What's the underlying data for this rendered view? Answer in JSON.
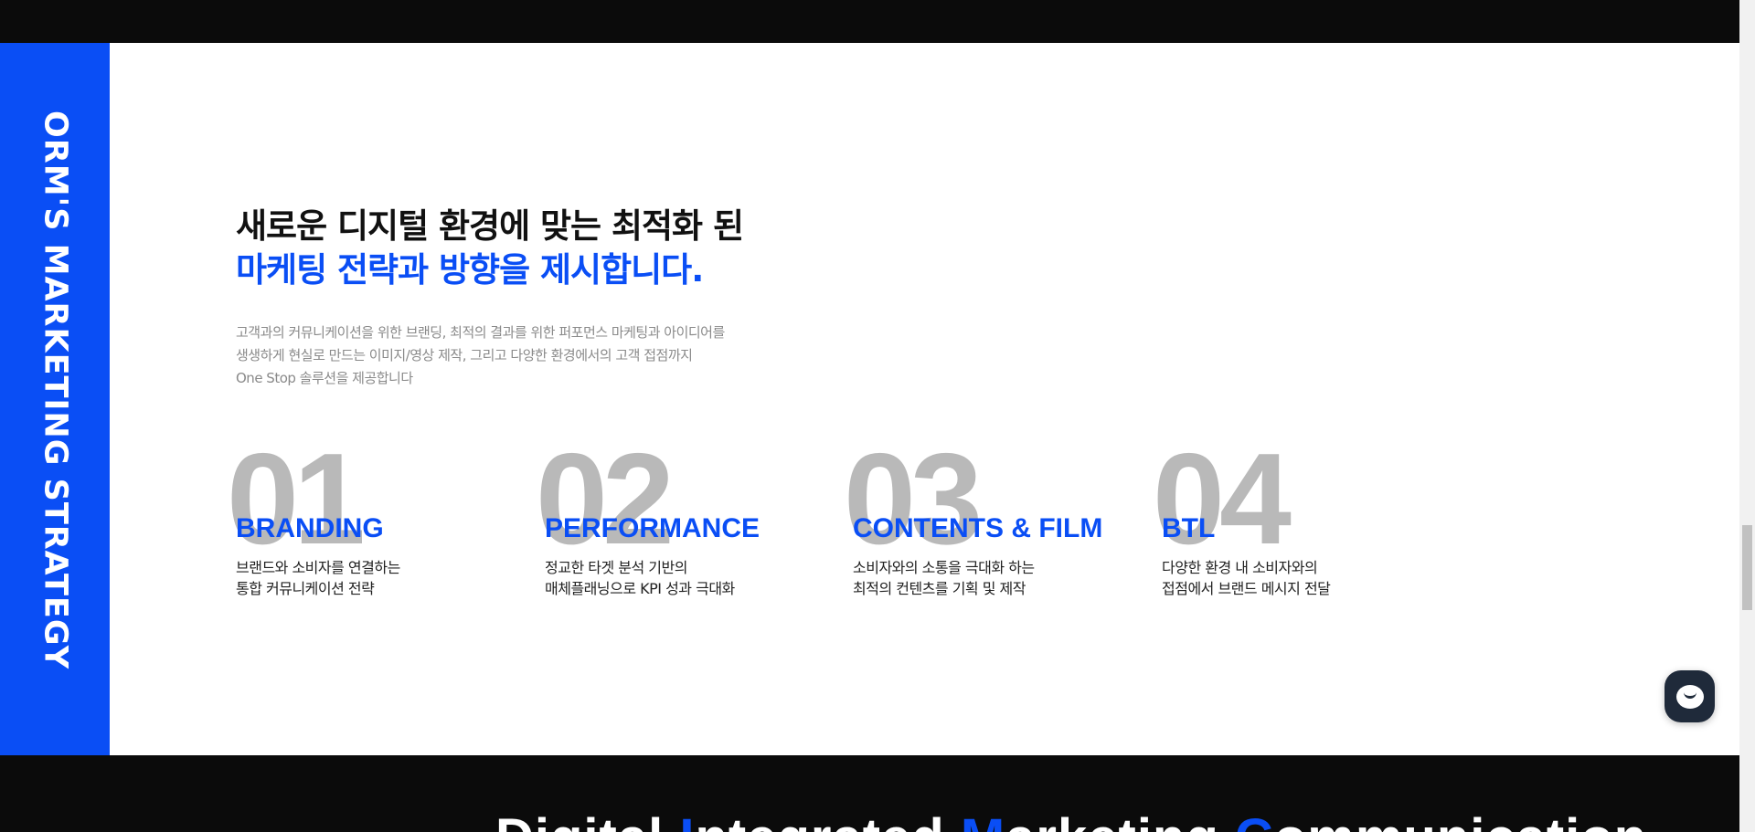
{
  "side_band": {
    "label": "ORM'S MARKETING STRATEGY"
  },
  "heading": {
    "line1": "새로운 디지털 환경에 맞는 최적화 된",
    "line2": "마케팅 전략과 방향을 제시합니다."
  },
  "description": {
    "line1": "고객과의 커뮤니케이션을 위한 브랜딩, 최적의 결과를 위한 퍼포먼스 마케팅과 아이디어를",
    "line2": "생생하게 현실로 만드는 이미지/영상 제작, 그리고 다양한 환경에서의 고객 접점까지",
    "line3": "One Stop 솔루션을 제공합니다"
  },
  "features": [
    {
      "number": "01",
      "title": "BRANDING",
      "desc1": "브랜드와 소비자를 연결하는",
      "desc2": "통합 커뮤니케이션 전략"
    },
    {
      "number": "02",
      "title": "PERFORMANCE",
      "desc1": "정교한 타겟 분석 기반의",
      "desc2": "매체플래닝으로 KPI 성과 극대화"
    },
    {
      "number": "03",
      "title": "CONTENTS & FILM",
      "desc1": "소비자와의 소통을 극대화 하는",
      "desc2": "최적의 컨텐츠를 기획 및 제작"
    },
    {
      "number": "04",
      "title": "BTL",
      "desc1": "다양한 환경 내 소비자와의",
      "desc2": "접점에서 브랜드 메시지 전달"
    }
  ],
  "bottom_heading": {
    "w1": "Digital ",
    "w2_initial": "I",
    "w2_rest": "ntegrated ",
    "w3_initial": "M",
    "w3_rest": "arketing ",
    "w4_initial": "C",
    "w4_rest": "ommunication"
  },
  "chat": {
    "icon": "chat-bubble-icon"
  },
  "colors": {
    "accent": "#0a4ef5",
    "dark": "#0b0b0b",
    "number_gray": "#b9b9b9"
  }
}
